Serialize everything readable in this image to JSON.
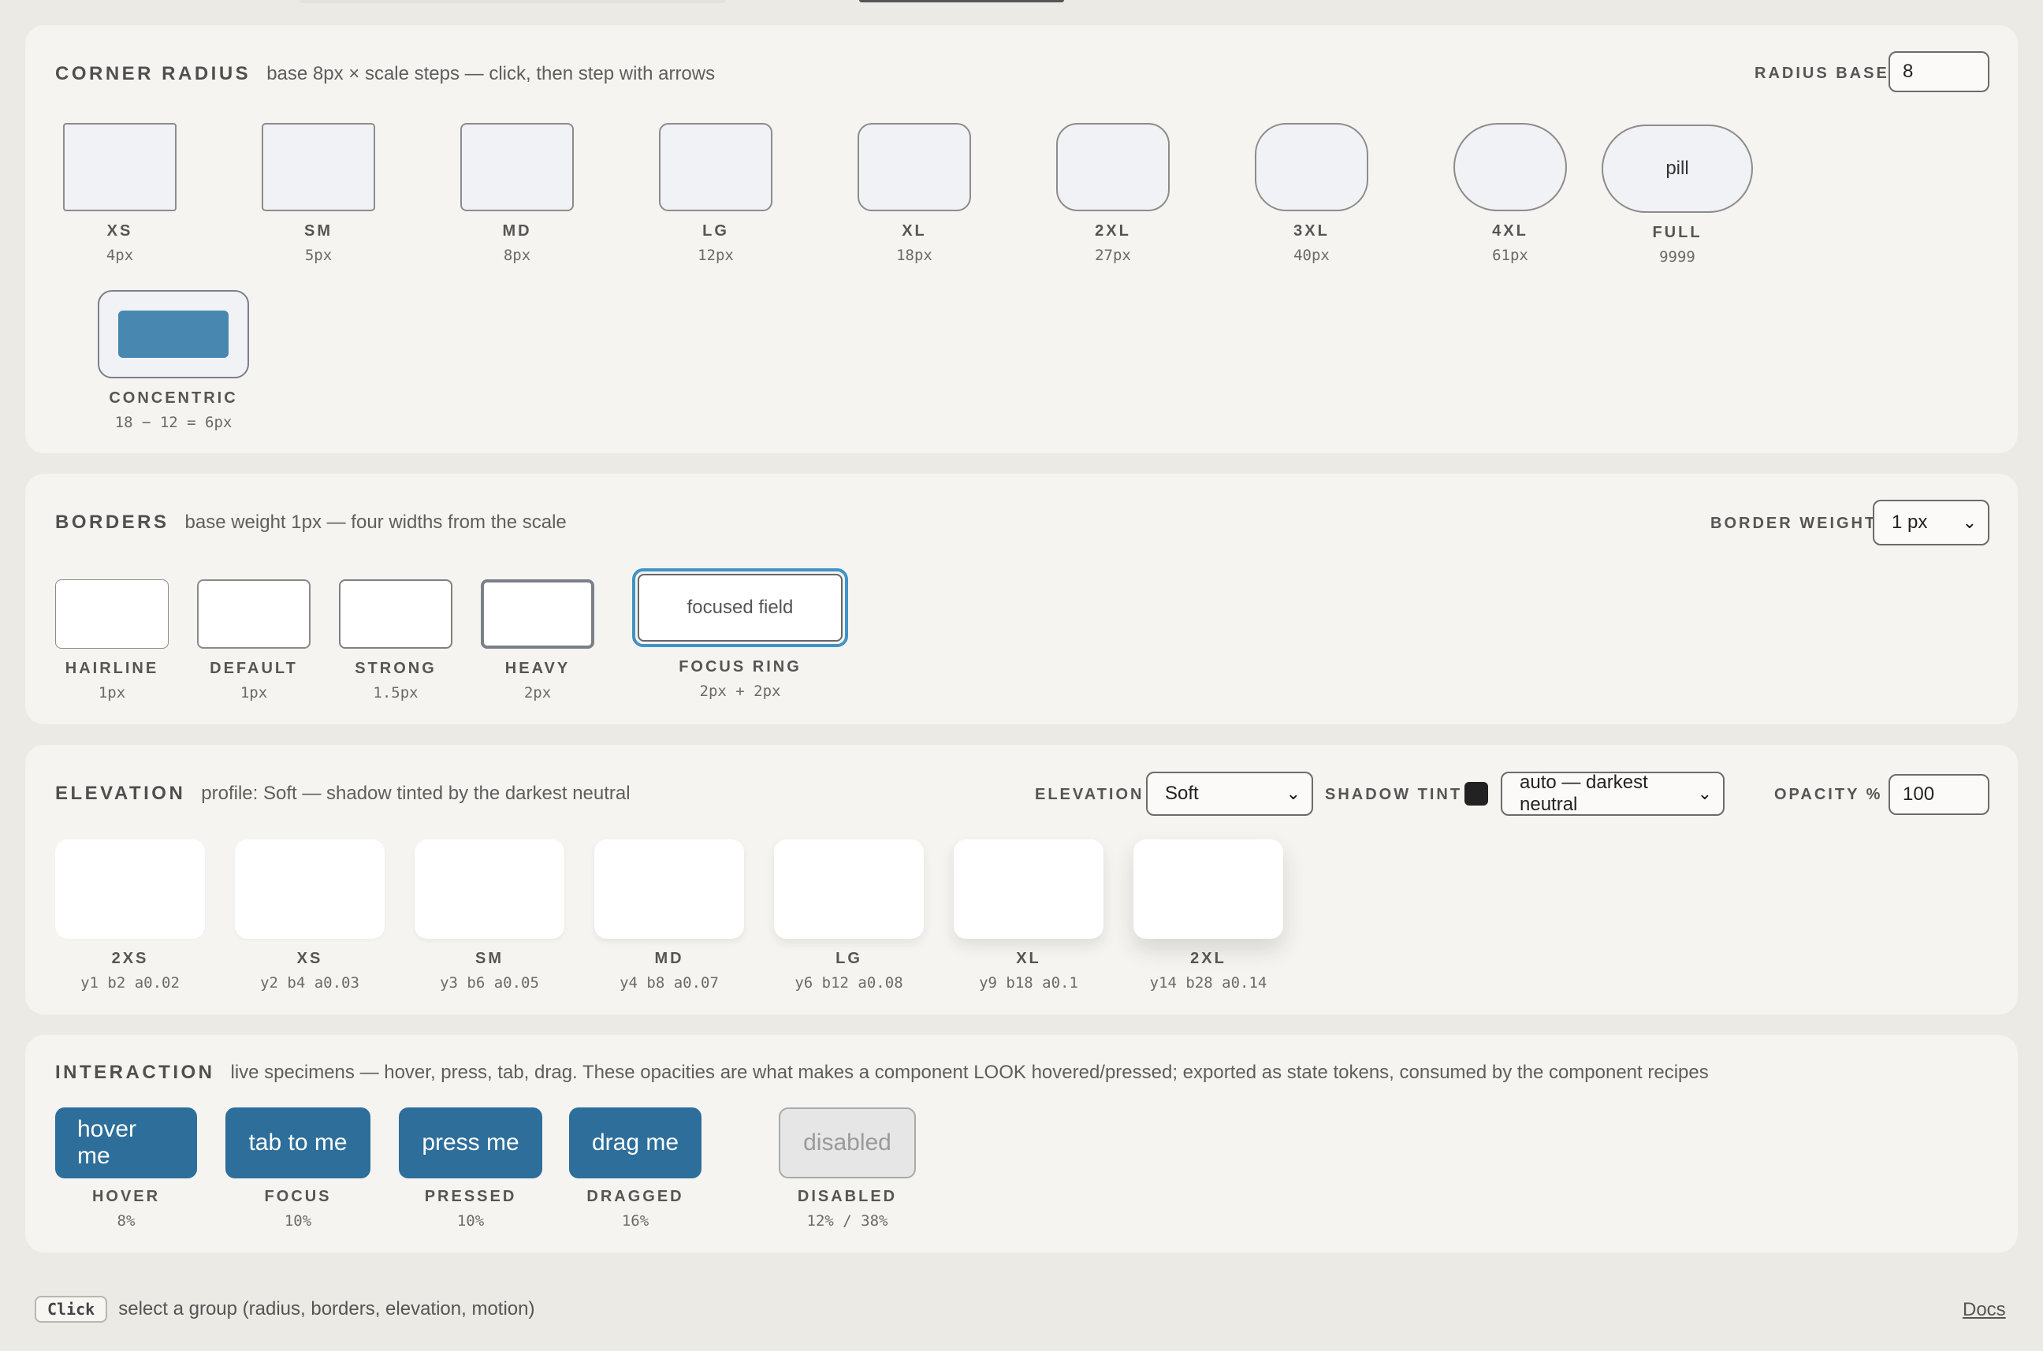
{
  "radius": {
    "title": "CORNER RADIUS",
    "subtitle": "base 8px × scale steps — click, then step with arrows",
    "control_label": "RADIUS BASE",
    "control_value": "8",
    "steps": [
      {
        "label": "XS",
        "value": "4px"
      },
      {
        "label": "SM",
        "value": "5px"
      },
      {
        "label": "MD",
        "value": "8px"
      },
      {
        "label": "LG",
        "value": "12px"
      },
      {
        "label": "XL",
        "value": "18px"
      },
      {
        "label": "2XL",
        "value": "27px"
      },
      {
        "label": "3XL",
        "value": "40px"
      },
      {
        "label": "4XL",
        "value": "61px"
      }
    ],
    "full": {
      "label": "FULL",
      "value": "9999",
      "text": "pill"
    },
    "concentric": {
      "label": "CONCENTRIC",
      "value": "18 − 12 = 6px"
    }
  },
  "borders": {
    "title": "BORDERS",
    "subtitle": "base weight 1px — four widths from the scale",
    "control_label": "BORDER WEIGHT",
    "control_value": "1 px",
    "items": [
      {
        "label": "HAIRLINE",
        "value": "1px"
      },
      {
        "label": "DEFAULT",
        "value": "1px"
      },
      {
        "label": "STRONG",
        "value": "1.5px"
      },
      {
        "label": "HEAVY",
        "value": "2px"
      }
    ],
    "focus": {
      "label": "FOCUS RING",
      "value": "2px + 2px",
      "text": "focused field"
    }
  },
  "elevation": {
    "title": "ELEVATION",
    "subtitle": "profile: Soft — shadow tinted by the darkest neutral",
    "elevation_label": "ELEVATION",
    "elevation_value": "Soft",
    "tint_label": "SHADOW TINT",
    "tint_color": "#222222",
    "tint_value": "auto — darkest neutral",
    "opacity_label": "OPACITY %",
    "opacity_value": "100",
    "levels": [
      {
        "label": "2XS",
        "value": "y1 b2 a0.02"
      },
      {
        "label": "XS",
        "value": "y2 b4 a0.03"
      },
      {
        "label": "SM",
        "value": "y3 b6 a0.05"
      },
      {
        "label": "MD",
        "value": "y4 b8 a0.07"
      },
      {
        "label": "LG",
        "value": "y6 b12 a0.08"
      },
      {
        "label": "XL",
        "value": "y9 b18 a0.1"
      },
      {
        "label": "2XL",
        "value": "y14 b28 a0.14"
      }
    ]
  },
  "interaction": {
    "title": "INTERACTION",
    "subtitle": "live specimens — hover, press, tab, drag. These opacities are what makes a component LOOK hovered/pressed; exported as state tokens, consumed by the component recipes",
    "buttons": [
      {
        "text": "hover me",
        "label": "HOVER",
        "value": "8%"
      },
      {
        "text": "tab to me",
        "label": "FOCUS",
        "value": "10%"
      },
      {
        "text": "press me",
        "label": "PRESSED",
        "value": "10%"
      },
      {
        "text": "drag me",
        "label": "DRAGGED",
        "value": "16%"
      },
      {
        "text": "disabled",
        "label": "DISABLED",
        "value": "12% / 38%"
      }
    ],
    "accent": "#2d6e9a"
  },
  "footer": {
    "key": "Click",
    "hint": "select a group (radius, borders, elevation, motion)",
    "docs": "Docs"
  }
}
